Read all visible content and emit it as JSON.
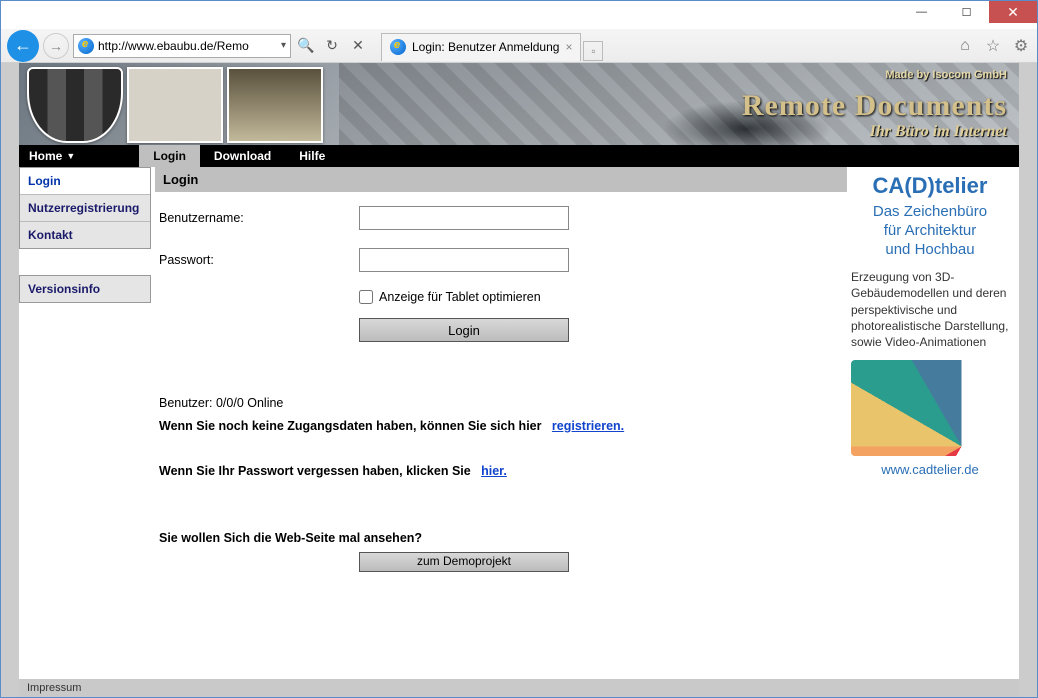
{
  "browser": {
    "url": "http://www.ebaubu.de/Remo",
    "tab_title": "Login: Benutzer Anmeldung"
  },
  "banner": {
    "made_by": "Made by Isocom GmbH",
    "title": "Remote Documents",
    "subtitle": "Ihr Büro im Internet"
  },
  "topnav": {
    "home": "Home",
    "login": "Login",
    "download": "Download",
    "hilfe": "Hilfe"
  },
  "sidenav": {
    "login": "Login",
    "nutzerreg": "Nutzerregistrierung",
    "kontakt": "Kontakt",
    "versionsinfo": "Versionsinfo"
  },
  "login": {
    "heading": "Login",
    "username_label": "Benutzername:",
    "password_label": "Passwort:",
    "tablet_label": "Anzeige für Tablet optimieren",
    "submit": "Login",
    "online_text": "Benutzer: 0/0/0 Online",
    "register_pre": "Wenn Sie noch keine Zugangsdaten haben, können Sie sich hier",
    "register_link": "registrieren.",
    "forgot_pre": "Wenn Sie Ihr Passwort vergessen haben, klicken Sie",
    "forgot_link": "hier.",
    "demo_q": "Sie wollen Sich die Web-Seite mal ansehen?",
    "demo_btn": "zum Demoprojekt"
  },
  "ad": {
    "title": "CA(D)telier",
    "sub1": "Das Zeichenbüro",
    "sub2": "für Architektur",
    "sub3": "und Hochbau",
    "body": "Erzeugung von 3D-Gebäudemodellen und deren perspektivische und photorealistische Darstellung, sowie Video-Animationen",
    "url": "www.cadtelier.de"
  },
  "footer": {
    "impressum": "Impressum"
  }
}
